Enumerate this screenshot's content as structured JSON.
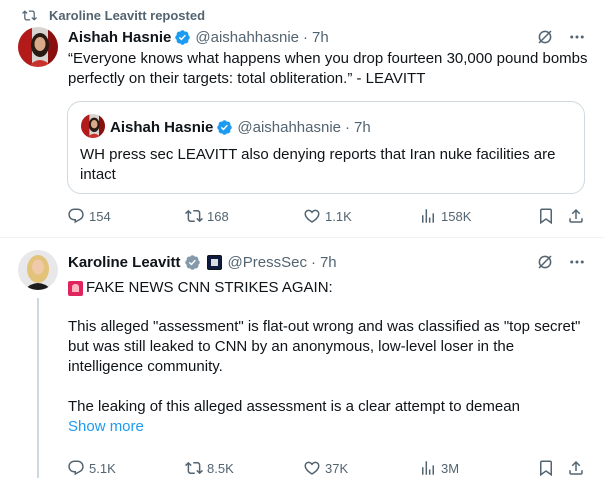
{
  "tweet1": {
    "repost_label": "Karoline Leavitt reposted",
    "author_name": "Aishah Hasnie",
    "handle": "@aishahhasnie",
    "separator": "·",
    "time": "7h",
    "text": "“Everyone knows what happens when you drop fourteen 30,000 pound bombs perfectly on their targets: total obliteration.” - LEAVITT",
    "quote": {
      "author_name": "Aishah Hasnie",
      "handle": "@aishahhasnie",
      "separator": "·",
      "time": "7h",
      "text": "WH press sec LEAVITT also denying reports that Iran nuke facilities are intact"
    },
    "stats": {
      "replies": "154",
      "reposts": "168",
      "likes": "1.1K",
      "views": "158K"
    }
  },
  "tweet2": {
    "author_name": "Karoline Leavitt",
    "handle": "@PressSec",
    "separator": "·",
    "time": "7h",
    "line1": "FAKE NEWS CNN STRIKES AGAIN:",
    "para1": "This alleged \"assessment\" is flat-out wrong and was classified as \"top secret\" but was still leaked to CNN by an anonymous, low-level loser in the intelligence community.",
    "para2": "The leaking of this alleged assessment is a clear attempt to demean",
    "show_more": "Show more",
    "stats": {
      "replies": "5.1K",
      "reposts": "8.5K",
      "likes": "37K",
      "views": "3M"
    }
  },
  "icons": {
    "repost": "repost-icon",
    "verified": "verified-badge-icon",
    "grok": "grok-icon",
    "more": "more-icon",
    "reply": "reply-icon",
    "like": "heart-icon",
    "views": "views-icon",
    "bookmark": "bookmark-icon",
    "share": "share-icon"
  },
  "colors": {
    "text": "#0f1419",
    "secondary": "#536471",
    "link": "#1d9bf0",
    "verified_blue": "#1d9bf0",
    "verified_gray": "#829aab",
    "border": "#cfd9de"
  }
}
